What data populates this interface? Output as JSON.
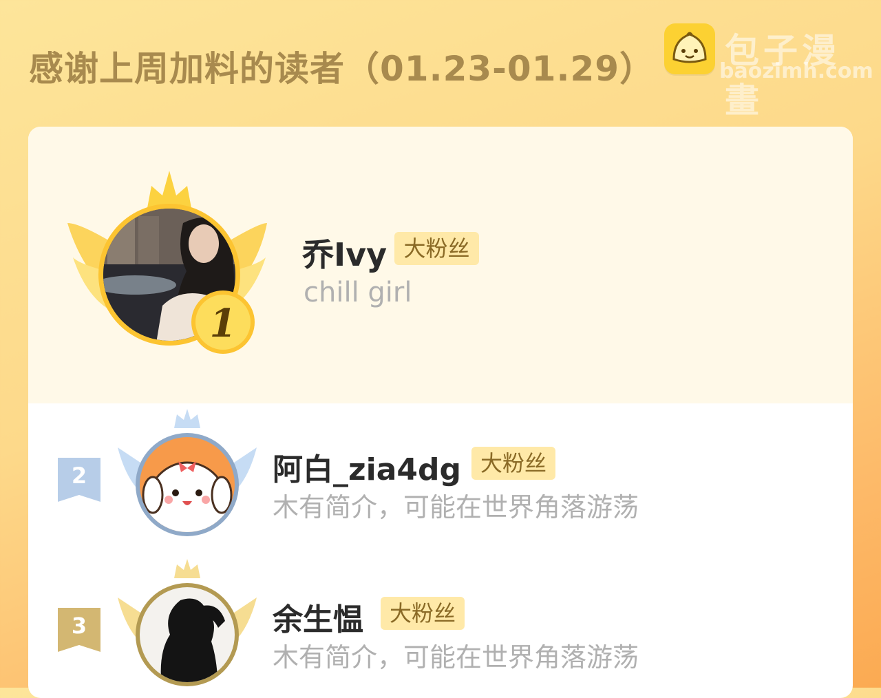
{
  "header": {
    "title": "感谢上周加料的读者（01.23-01.29）"
  },
  "logo": {
    "name": "包子漫畫",
    "domain": "baozimh.com",
    "icon": "bun-mascot-icon"
  },
  "readers": [
    {
      "rank": "1",
      "name": "乔Ivy",
      "badge": "大粉丝",
      "bio": "chill girl"
    },
    {
      "rank": "2",
      "name": "阿白_zia4dg",
      "badge": "大粉丝",
      "bio": "木有简介，可能在世界角落游荡"
    },
    {
      "rank": "3",
      "name": "余生愠",
      "badge": "大粉丝",
      "bio": "木有简介，可能在世界角落游荡"
    }
  ],
  "colors": {
    "title": "#a88a4e",
    "gold": "#fcc431",
    "silver": "#9fbde0",
    "bronze": "#c8a862",
    "badge_bg": "#ffe9a8"
  }
}
